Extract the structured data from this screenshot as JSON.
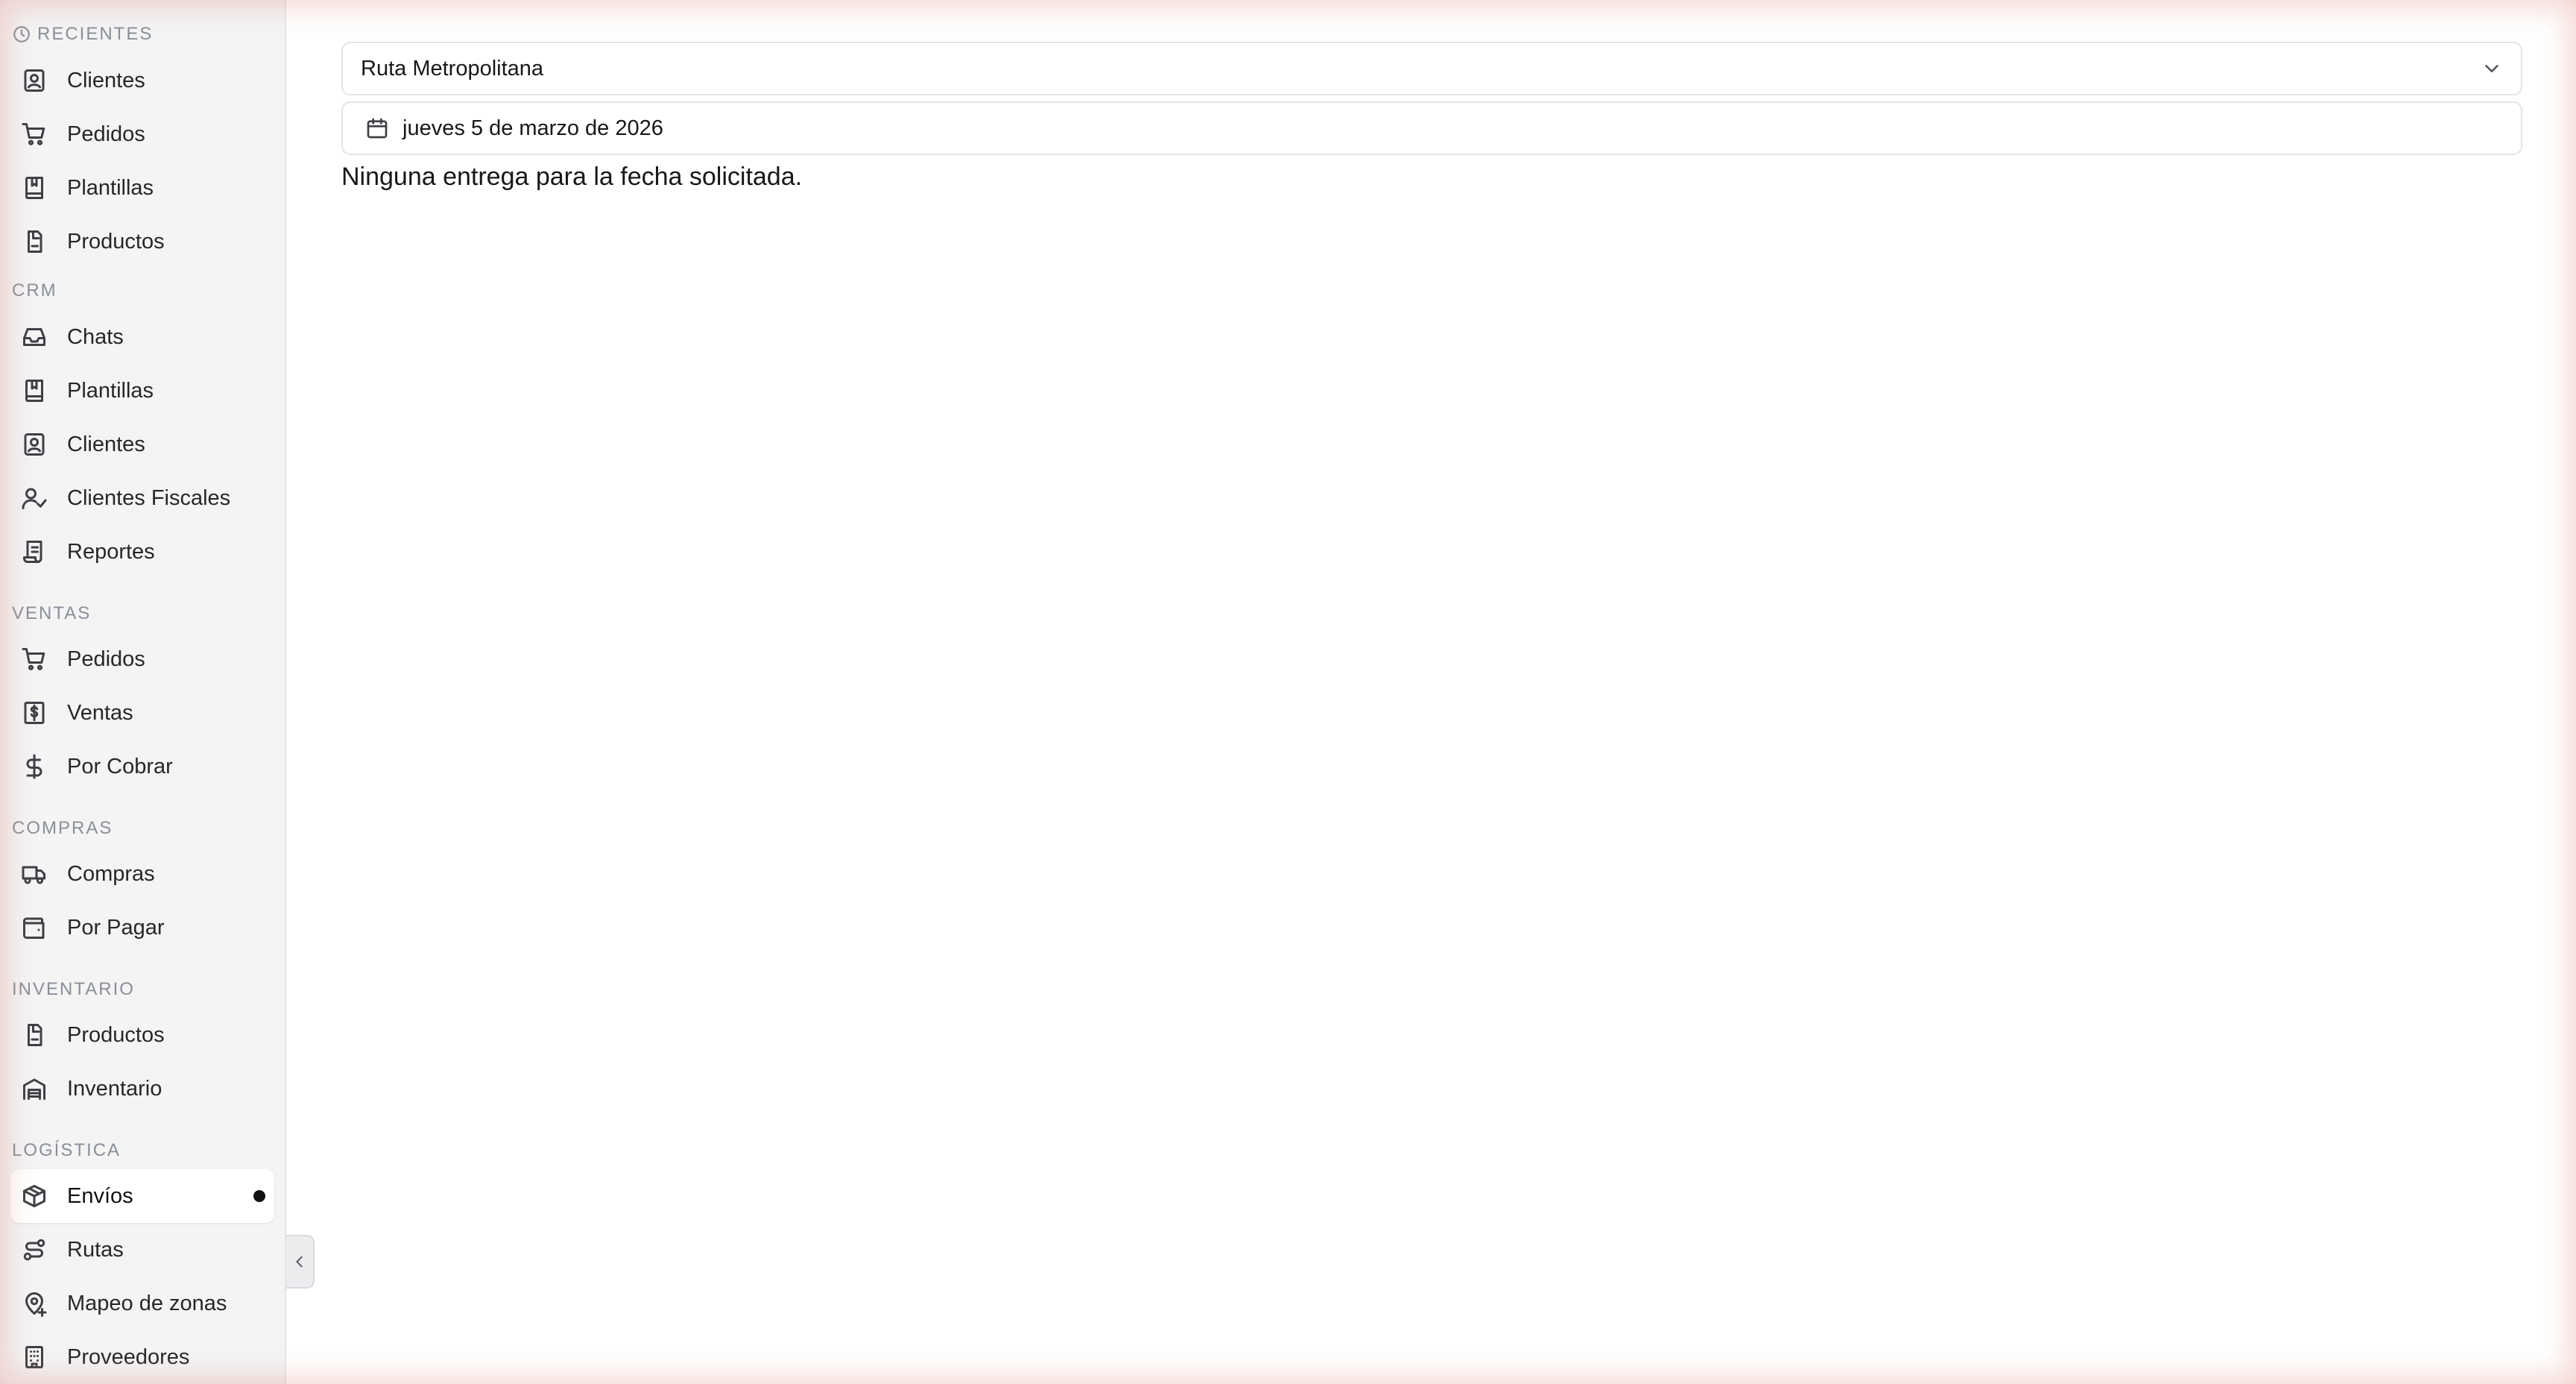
{
  "sidebar": {
    "sections": {
      "recientes": "RECIENTES",
      "crm": "CRM",
      "ventas": "VENTAS",
      "compras": "COMPRAS",
      "inventario": "INVENTARIO",
      "logistica": "LOGÍSTICA"
    },
    "recientes": [
      {
        "label": "Clientes",
        "icon": "contact-icon"
      },
      {
        "label": "Pedidos",
        "icon": "cart-icon"
      },
      {
        "label": "Plantillas",
        "icon": "book-icon"
      },
      {
        "label": "Productos",
        "icon": "package-icon"
      }
    ],
    "crm": [
      {
        "label": "Chats",
        "icon": "inbox-icon"
      },
      {
        "label": "Plantillas",
        "icon": "book-icon"
      },
      {
        "label": "Clientes",
        "icon": "contact-icon"
      },
      {
        "label": "Clientes Fiscales",
        "icon": "user-check-icon"
      },
      {
        "label": "Reportes",
        "icon": "scroll-icon"
      }
    ],
    "ventas": [
      {
        "label": "Pedidos",
        "icon": "cart-icon"
      },
      {
        "label": "Ventas",
        "icon": "receipt-dollar-icon"
      },
      {
        "label": "Por Cobrar",
        "icon": "dollar-icon"
      }
    ],
    "compras": [
      {
        "label": "Compras",
        "icon": "truck-icon"
      },
      {
        "label": "Por Pagar",
        "icon": "wallet-icon"
      }
    ],
    "inventario": [
      {
        "label": "Productos",
        "icon": "package-icon"
      },
      {
        "label": "Inventario",
        "icon": "warehouse-icon"
      }
    ],
    "logistica": [
      {
        "label": "Envíos",
        "icon": "box-icon",
        "active": true
      },
      {
        "label": "Rutas",
        "icon": "route-icon"
      },
      {
        "label": "Mapeo de zonas",
        "icon": "map-pin-icon"
      },
      {
        "label": "Proveedores",
        "icon": "building-icon"
      }
    ]
  },
  "main": {
    "route_select": {
      "value": "Ruta Metropolitana"
    },
    "date_picker": {
      "value": "jueves 5 de marzo de 2026"
    },
    "empty_message": "Ninguna entrega para la fecha solicitada."
  }
}
